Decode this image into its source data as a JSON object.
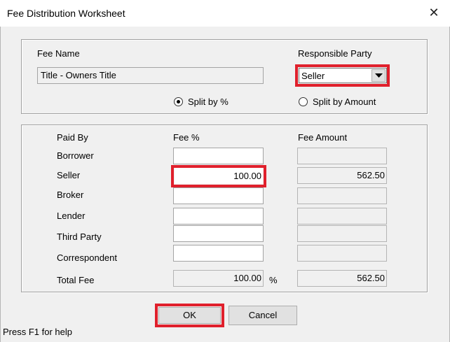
{
  "window": {
    "title": "Fee Distribution Worksheet",
    "close_glyph": "✕"
  },
  "fee": {
    "name_label": "Fee Name",
    "name_value": "Title - Owners Title",
    "responsible_label": "Responsible Party",
    "responsible_value": "Seller",
    "split_by_percent": "Split by %",
    "split_by_amount": "Split by Amount",
    "split_selected": "percent"
  },
  "table": {
    "headers": {
      "paid_by": "Paid By",
      "fee_percent": "Fee %",
      "fee_amount": "Fee Amount"
    },
    "rows": [
      {
        "label": "Borrower",
        "percent": "",
        "amount": ""
      },
      {
        "label": "Seller",
        "percent": "100.00",
        "amount": "562.50"
      },
      {
        "label": "Broker",
        "percent": "",
        "amount": ""
      },
      {
        "label": "Lender",
        "percent": "",
        "amount": ""
      },
      {
        "label": "Third Party",
        "percent": "",
        "amount": ""
      },
      {
        "label": "Correspondent",
        "percent": "",
        "amount": ""
      }
    ],
    "total": {
      "label": "Total Fee",
      "percent": "100.00",
      "percent_unit": "%",
      "amount": "562.50"
    }
  },
  "buttons": {
    "ok": "OK",
    "cancel": "Cancel"
  },
  "status": {
    "help": "Press F1 for help"
  },
  "colors": {
    "highlight": "#e0202c",
    "dialog_bg": "#f0f0f0"
  }
}
